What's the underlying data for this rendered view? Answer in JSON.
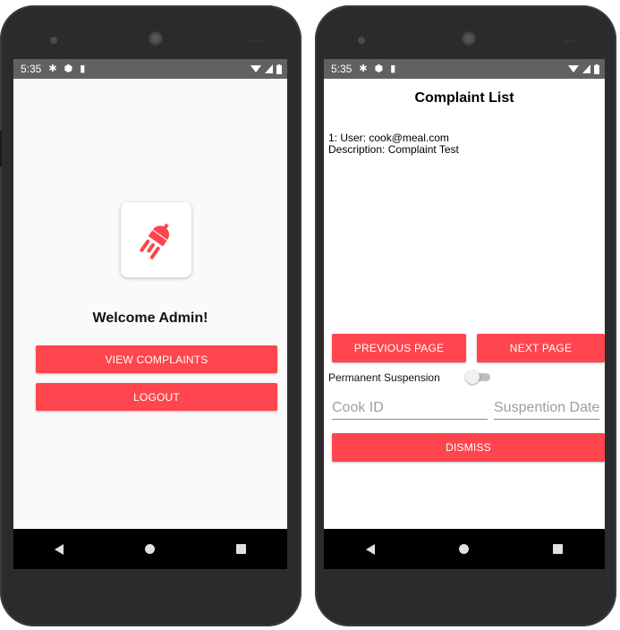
{
  "left_screen": {
    "status": {
      "time": "5:35"
    },
    "welcome_text": "Welcome Admin!",
    "buttons": {
      "view_complaints": "VIEW COMPLAINTS",
      "logout": "LOGOUT"
    },
    "logo_icon": "rocket-robot-icon"
  },
  "right_screen": {
    "status": {
      "time": "5:35"
    },
    "title": "Complaint List",
    "complaint": {
      "user_line": "1: User: cook@meal.com",
      "description_line": "Description: Complaint Test"
    },
    "buttons": {
      "previous_page": "PREVIOUS PAGE",
      "next_page": "NEXT PAGE",
      "dismiss": "DISMISS"
    },
    "permanent_suspension_label": "Permanent Suspension",
    "permanent_suspension_on": false,
    "inputs": {
      "cook_id_placeholder": "Cook ID",
      "suspension_date_placeholder": "Suspention Date"
    }
  },
  "colors": {
    "accent": "#ff454d",
    "status_bar": "#616161",
    "nav_bar": "#000000"
  }
}
